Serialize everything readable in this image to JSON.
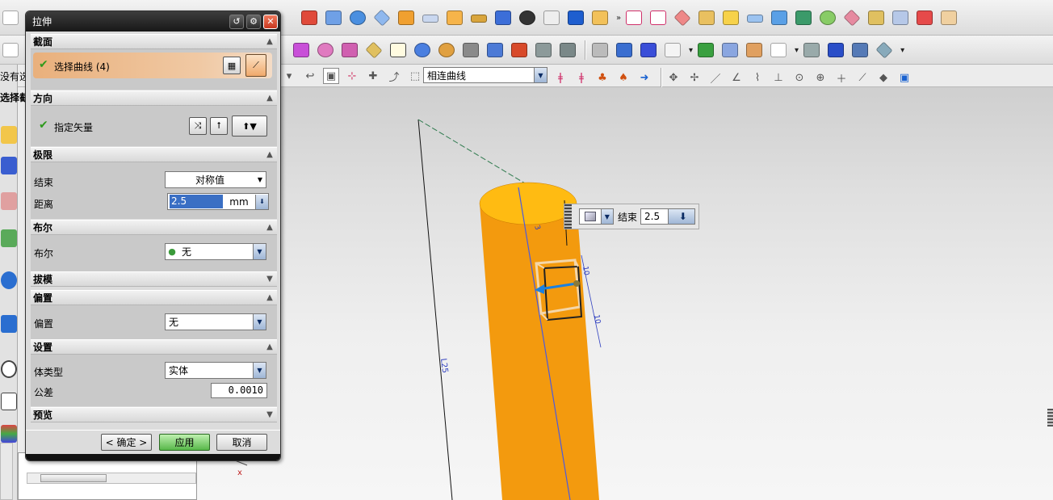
{
  "toolbar": {
    "curve_rule": "相连曲线"
  },
  "left_strip": {
    "label1": "没有选",
    "label2": "选择截"
  },
  "dialog": {
    "title": "拉伸",
    "section": {
      "title": "截面",
      "select_curve_label": "选择曲线 (4)"
    },
    "direction": {
      "title": "方向",
      "specify_vector_label": "指定矢量"
    },
    "limits": {
      "title": "极限",
      "end_label": "结束",
      "end_value": "对称值",
      "distance_label": "距离",
      "distance_value": "2.5",
      "distance_unit": "mm"
    },
    "boolean": {
      "title": "布尔",
      "label": "布尔",
      "value": "无"
    },
    "draft": {
      "title": "拔模"
    },
    "offset": {
      "title": "偏置",
      "label": "偏置",
      "value": "无"
    },
    "settings": {
      "title": "设置",
      "body_type_label": "体类型",
      "body_type_value": "实体",
      "tolerance_label": "公差",
      "tolerance_value": "0.0010"
    },
    "preview": {
      "title": "预览"
    },
    "buttons": {
      "ok": "< 确定 >",
      "apply": "应用",
      "cancel": "取消"
    }
  },
  "float_input": {
    "label": "结束",
    "value": "2.5"
  },
  "colors": {
    "cylinder": "#f39a0e",
    "cylinder_top": "#ffbb12",
    "dialog_title_bg": "#222222",
    "highlight": "#efbd92",
    "apply_button": "#6fc85f"
  }
}
